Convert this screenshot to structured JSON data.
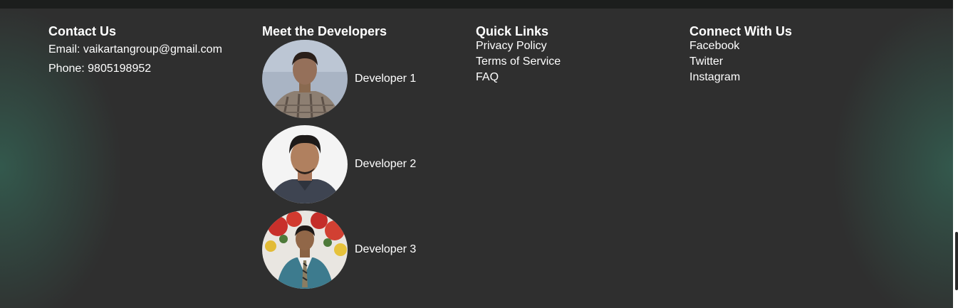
{
  "contact": {
    "title": "Contact Us",
    "email": "Email: vaikartangroup@gmail.com",
    "phone": "Phone: 9805198952"
  },
  "developers": {
    "title": "Meet the Developers",
    "items": [
      {
        "name": "Developer 1"
      },
      {
        "name": "Developer 2"
      },
      {
        "name": "Developer 3"
      }
    ]
  },
  "quick_links": {
    "title": "Quick Links",
    "items": [
      "Privacy Policy",
      "Terms of Service",
      "FAQ"
    ]
  },
  "social": {
    "title": "Connect With Us",
    "items": [
      "Facebook",
      "Twitter",
      "Instagram"
    ]
  },
  "colors": {
    "background": "#2f2f2f",
    "glow": "#346052",
    "text": "#ffffff",
    "top_bar": "#1c1e1d"
  }
}
